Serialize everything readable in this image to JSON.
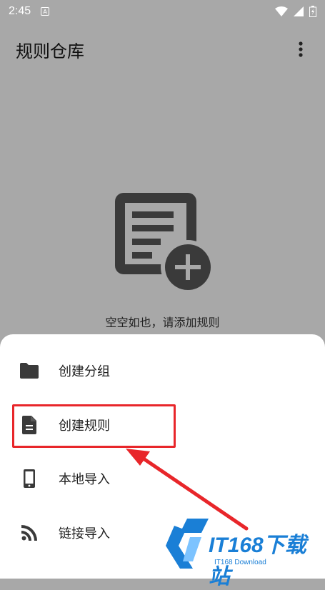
{
  "status_bar": {
    "time": "2:45"
  },
  "app_bar": {
    "title": "规则仓库"
  },
  "empty_state": {
    "message": "空空如也，请添加规则"
  },
  "sheet": {
    "items": [
      {
        "label": "创建分组",
        "icon": "folder-icon"
      },
      {
        "label": "创建规则",
        "icon": "document-icon"
      },
      {
        "label": "本地导入",
        "icon": "phone-icon"
      },
      {
        "label": "链接导入",
        "icon": "rss-icon"
      }
    ]
  },
  "watermark": {
    "brand": "IT168下载站",
    "sub": "IT168 Download"
  },
  "colors": {
    "scrim": "#a8a8a8",
    "highlight": "#e8262a",
    "watermark": "#1a7fd6",
    "icon": "#333333"
  }
}
